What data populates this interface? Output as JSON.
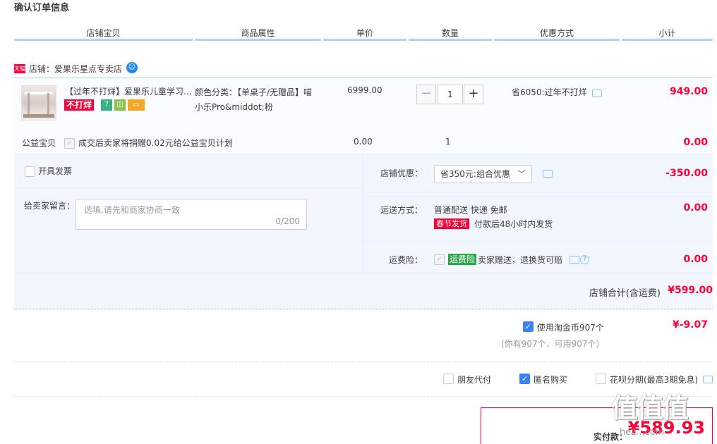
{
  "page": {
    "title": "确认订单信息"
  },
  "columns": [
    "店铺宝贝",
    "商品属性",
    "单价",
    "数量",
    "优惠方式",
    "小计"
  ],
  "shop": {
    "badge": "天猫",
    "name": "店铺：爱果乐星点专卖店"
  },
  "item": {
    "title": "【过年不打烊】爱果乐儿童学习...",
    "tag": "不打烊",
    "attr_line1": "颜色分类：【单桌子/无赠品】喵",
    "attr_line2": "小乐Pro&middot;粉",
    "unit_price": "6999.00",
    "quantity": "1",
    "discount": "省6050:过年不打烊",
    "subtotal": "949.00"
  },
  "charity": {
    "label": "公益宝贝",
    "text": "成交后卖家将捐赠0.02元给公益宝贝计划",
    "price": "0.00",
    "qty": "1",
    "subtotal": "0.00"
  },
  "invoice": {
    "label": "开具发票",
    "checked": false
  },
  "message": {
    "label": "给卖家留言：",
    "placeholder": "选填,请先和商家协商一致",
    "counter": "0/200"
  },
  "shop_discount": {
    "label": "店铺优惠：",
    "selected": "省350元:组合优惠",
    "value": "-350.00"
  },
  "shipping": {
    "label": "运送方式：",
    "line1": "普通配送 快递 免邮",
    "tag": "春节发货",
    "note": "付款后48小时内发货",
    "value": "0.00"
  },
  "insurance": {
    "label": "运费险：",
    "tag": "运费险",
    "text": "卖家赠送，退换货可赔",
    "value": "0.00"
  },
  "shop_total": {
    "label": "店铺合计(含运费)",
    "value": "¥599.00"
  },
  "coins": {
    "label": "使用淘金币907个",
    "checked": true,
    "note": "(你有907个，可用907个)",
    "value": "¥-9.07"
  },
  "options": {
    "friend_pay": {
      "label": "朋友代付",
      "checked": false
    },
    "anonymous": {
      "label": "匿名购买",
      "checked": true
    },
    "huabei": {
      "label": "花呗分期(最高3期免息)",
      "checked": false
    }
  },
  "payment": {
    "label": "实付款：",
    "value": "¥589.93"
  },
  "watermark": {
    "text": "值值值",
    "url": "hez...com"
  },
  "colors": {
    "accent": "#ff0036",
    "header_line": "#b2d1ff",
    "panel_bg": "#f2f7ff",
    "checkbox_on": "#3b82f6"
  }
}
